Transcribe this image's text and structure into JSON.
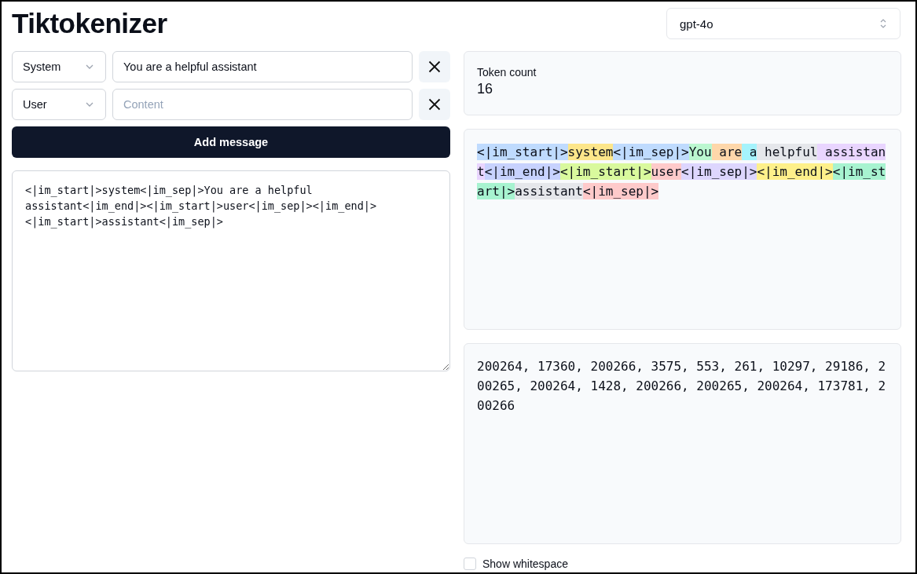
{
  "title": "Tiktokenizer",
  "model_select": {
    "value": "gpt-4o"
  },
  "messages": [
    {
      "role": "System",
      "content": "You are a helpful assistant"
    },
    {
      "role": "User",
      "placeholder": "Content"
    }
  ],
  "add_button": "Add message",
  "prompt_text": "<|im_start|>system<|im_sep|>You are a helpful assistant<|im_end|><|im_start|>user<|im_sep|><|im_end|><|im_start|>assistant<|im_sep|>",
  "token_count": {
    "label": "Token count",
    "value": "16"
  },
  "tokens": [
    {
      "text": "<|im_start|>",
      "color": "#bfdbfe"
    },
    {
      "text": "system",
      "color": "#fde68a"
    },
    {
      "text": "<|im_sep|>",
      "color": "#bfdbfe"
    },
    {
      "text": "You",
      "color": "#bbf7d0"
    },
    {
      "text": " are",
      "color": "#fed7aa"
    },
    {
      "text": " a",
      "color": "#a5f3fc"
    },
    {
      "text": " helpful",
      "color": "#e5e7eb"
    },
    {
      "text": " assistant",
      "color": "#e9d5ff"
    },
    {
      "text": "<|im_end|>",
      "color": "#c7d2fe"
    },
    {
      "text": "<|im_start|>",
      "color": "#d9f99d"
    },
    {
      "text": "user",
      "color": "#fecaca"
    },
    {
      "text": "<|im_sep|>",
      "color": "#ddd6fe"
    },
    {
      "text": "<|im_end|>",
      "color": "#fef08a"
    },
    {
      "text": "<|im_start|>",
      "color": "#a7f3d0"
    },
    {
      "text": "assistant",
      "color": "#e5e7eb"
    },
    {
      "text": "<|im_sep|>",
      "color": "#fecaca"
    }
  ],
  "token_ids": "200264, 17360, 200266, 3575, 553, 261, 10297, 29186, 200265, 200264, 1428, 200266, 200265, 200264, 173781, 200266",
  "show_whitespace": {
    "label": "Show whitespace",
    "checked": false
  }
}
